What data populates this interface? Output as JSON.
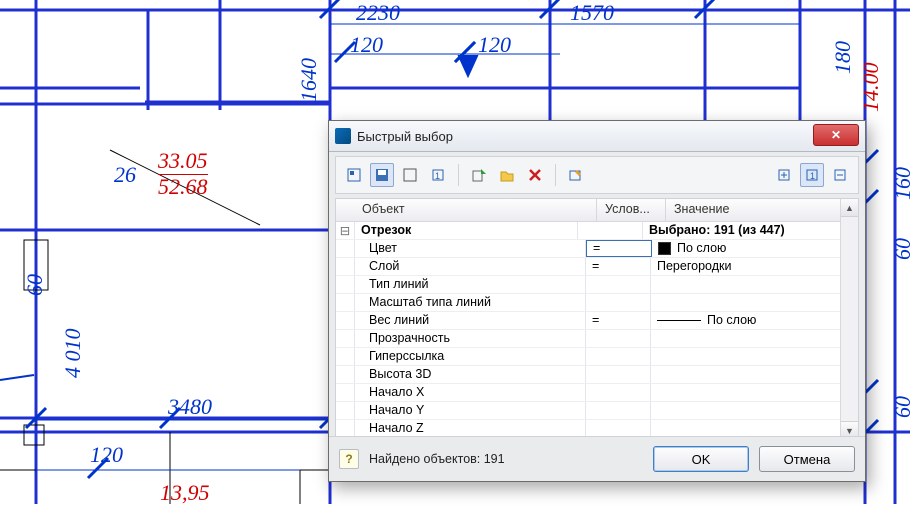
{
  "dialog": {
    "title": "Быстрый выбор",
    "columns": {
      "object": "Объект",
      "condition": "Услов...",
      "value": "Значение"
    },
    "header_row": {
      "object": "Отрезок",
      "value": "Выбрано: 191 (из 447)",
      "expand": "⊟"
    },
    "rows": [
      {
        "name": "Цвет",
        "cond": "=",
        "value": "По слою",
        "swatch": true,
        "selected": true
      },
      {
        "name": "Слой",
        "cond": "=",
        "value": "Перегородки"
      },
      {
        "name": "Тип линий",
        "cond": "",
        "value": ""
      },
      {
        "name": "Масштаб типа линий",
        "cond": "",
        "value": ""
      },
      {
        "name": "Вес линий",
        "cond": "=",
        "value": "По слою",
        "weight": true
      },
      {
        "name": "Прозрачность",
        "cond": "",
        "value": ""
      },
      {
        "name": "Гиперссылка",
        "cond": "",
        "value": ""
      },
      {
        "name": "Высота 3D",
        "cond": "",
        "value": ""
      },
      {
        "name": "Начало X",
        "cond": "",
        "value": ""
      },
      {
        "name": "Начало Y",
        "cond": "",
        "value": ""
      },
      {
        "name": "Начало Z",
        "cond": "",
        "value": ""
      }
    ],
    "status": "Найдено объектов: 191",
    "help": "?",
    "ok": "OK",
    "cancel": "Отмена",
    "close": "✕"
  },
  "dims": {
    "d2230": "2230",
    "d1570": "1570",
    "d120a": "120",
    "d120b": "120",
    "d1640": "1640",
    "d26": "26",
    "d3305": "33.05",
    "d5268": "52.68",
    "d60a": "60",
    "d4010": "4 010",
    "d3480": "3480",
    "d120c": "120",
    "d1395": "13,95",
    "d180": "180",
    "d1400": "14.00",
    "d160": "160",
    "d60b": "60",
    "d60c": "60"
  }
}
